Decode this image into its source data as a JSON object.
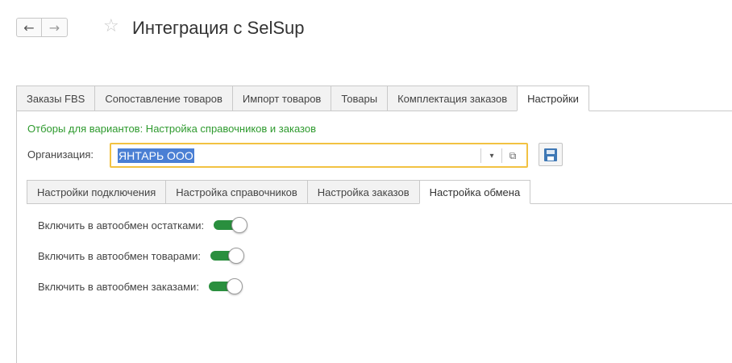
{
  "header": {
    "back_icon": "←",
    "forward_icon": "→",
    "favorite_icon": "☆",
    "title": "Интеграция с SelSup"
  },
  "outer_tabs": [
    {
      "label": "Заказы FBS",
      "active": false
    },
    {
      "label": "Сопоставление товаров",
      "active": false
    },
    {
      "label": "Импорт товаров",
      "active": false
    },
    {
      "label": "Товары",
      "active": false
    },
    {
      "label": "Комплектация заказов",
      "active": false
    },
    {
      "label": "Настройки",
      "active": true
    }
  ],
  "settings": {
    "filter_link": "Отборы для вариантов: Настройка справочников и заказов",
    "organization_label": "Организация:",
    "organization_value": "ЯНТАРЬ ООО",
    "dropdown_icon": "▾",
    "open_icon": "⧉"
  },
  "inner_tabs": [
    {
      "label": "Настройки подключения",
      "active": false
    },
    {
      "label": "Настройка справочников",
      "active": false
    },
    {
      "label": "Настройка заказов",
      "active": false
    },
    {
      "label": "Настройка обмена",
      "active": true
    }
  ],
  "exchange": {
    "toggles": [
      {
        "label": "Включить в автообмен остатками:",
        "on": true
      },
      {
        "label": "Включить в автообмен товарами:",
        "on": true
      },
      {
        "label": "Включить в автообмен заказами:",
        "on": true
      }
    ]
  },
  "colors": {
    "accent_green": "#2a8f3e",
    "link_green": "#2e9a2e",
    "field_focus": "#f2c242",
    "selection_blue": "#4a7fd4"
  }
}
